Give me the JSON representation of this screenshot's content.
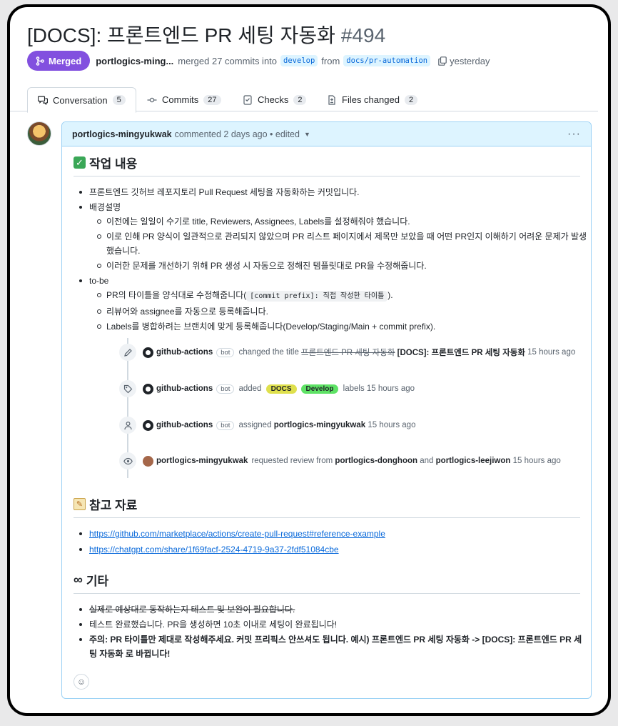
{
  "pr": {
    "title": "[DOCS]: 프론트엔드 PR 세팅 자동화",
    "number": "#494",
    "state": "Merged",
    "author": "portlogics-ming...",
    "action": "merged 27 commits into",
    "base": "develop",
    "from_text": "from",
    "head": "docs/pr-automation",
    "time": "yesterday"
  },
  "tabs": [
    {
      "label": "Conversation",
      "count": "5",
      "icon": "conversation-icon"
    },
    {
      "label": "Commits",
      "count": "27",
      "icon": "commit-icon"
    },
    {
      "label": "Checks",
      "count": "2",
      "icon": "checks-icon"
    },
    {
      "label": "Files changed",
      "count": "2",
      "icon": "file-diff-icon"
    }
  ],
  "comment": {
    "author": "portlogics-mingyukwak",
    "meta": "commented 2 days ago",
    "edited": "• edited",
    "more": "···"
  },
  "sections": {
    "work": {
      "heading": "작업 내용",
      "item1": "프론트엔드 깃허브 레포지토리 Pull Request 세팅을 자동화하는 커밋입니다.",
      "item2": "배경설명",
      "sub2": [
        "이전에는 일일이 수기로 title, Reviewers, Assignees, Labels를 설정해줘야 했습니다.",
        "이로 인해 PR 양식이 일관적으로 관리되지 않았으며 PR 리스트 페이지에서 제목만 보았을 때 어떤 PR인지 이해하기 어려운 문제가 발생",
        "했습니다.",
        "이러한 문제를 개선하기 위해 PR 생성 시 자동으로 정해진 템플릿대로 PR을 수정해줍니다."
      ],
      "item3": "to-be",
      "sub3_1_pre": "PR의 타이틀을 양식대로 수정해줍니다(",
      "sub3_1_code": "[commit prefix]: 직접 작성한 타이틀",
      "sub3_1_post": ").",
      "sub3_2": "리뷰어와 assignee를 자동으로 등록해줍니다.",
      "sub3_3": "Labels를 병합하려는 브랜치에 맞게 등록해줍니다(Develop/Staging/Main + commit prefix)."
    },
    "timeline": [
      {
        "actor": "github-actions",
        "bot": "bot",
        "icon": "pencil-icon",
        "text1": "changed the title",
        "old": "프론트엔드 PR 세팅 자동화",
        "new": "[DOCS]: 프론트엔드 PR 세팅 자동화",
        "time": "15 hours ago"
      },
      {
        "actor": "github-actions",
        "bot": "bot",
        "icon": "tag-icon",
        "text1": "added",
        "label1": "DOCS",
        "label2": "Develop",
        "text2": "labels",
        "time": "15 hours ago"
      },
      {
        "actor": "github-actions",
        "bot": "bot",
        "icon": "person-icon",
        "text1": "assigned",
        "target": "portlogics-mingyukwak",
        "time": "15 hours ago"
      },
      {
        "actor": "portlogics-mingyukwak",
        "icon": "eye-icon",
        "text1": "requested review from",
        "r1": "portlogics-donghoon",
        "and": "and",
        "r2": "portlogics-leejiwon",
        "time": "15 hours ago"
      }
    ],
    "refs": {
      "heading": "참고 자료",
      "link1": "https://github.com/marketplace/actions/create-pull-request#reference-example",
      "link2": "https://chatgpt.com/share/1f69facf-2524-4719-9a37-2fdf51084cbe"
    },
    "etc": {
      "heading": "기타",
      "item1": "실제로 예상대로 동작하는지 테스트 및 보완이 필요합니다.",
      "item2": "테스트 완료했습니다. PR을 생성하면 10초 이내로 세팅이 완료됩니다!",
      "item3a": "주의: PR 타이틀만 제대로 작성해주세요. 커밋 프리픽스 안쓰셔도 됩니다. 예시) 프론트엔드 PR 세팅 자동화 -> [DOCS]: 프론트엔드 PR 세",
      "item3b": "팅 자동화 로 바뀝니다!"
    }
  },
  "colors": {
    "merged": "#8250df",
    "link": "#0969da",
    "label_docs": "#dfe04d",
    "label_develop": "#5ee265"
  }
}
